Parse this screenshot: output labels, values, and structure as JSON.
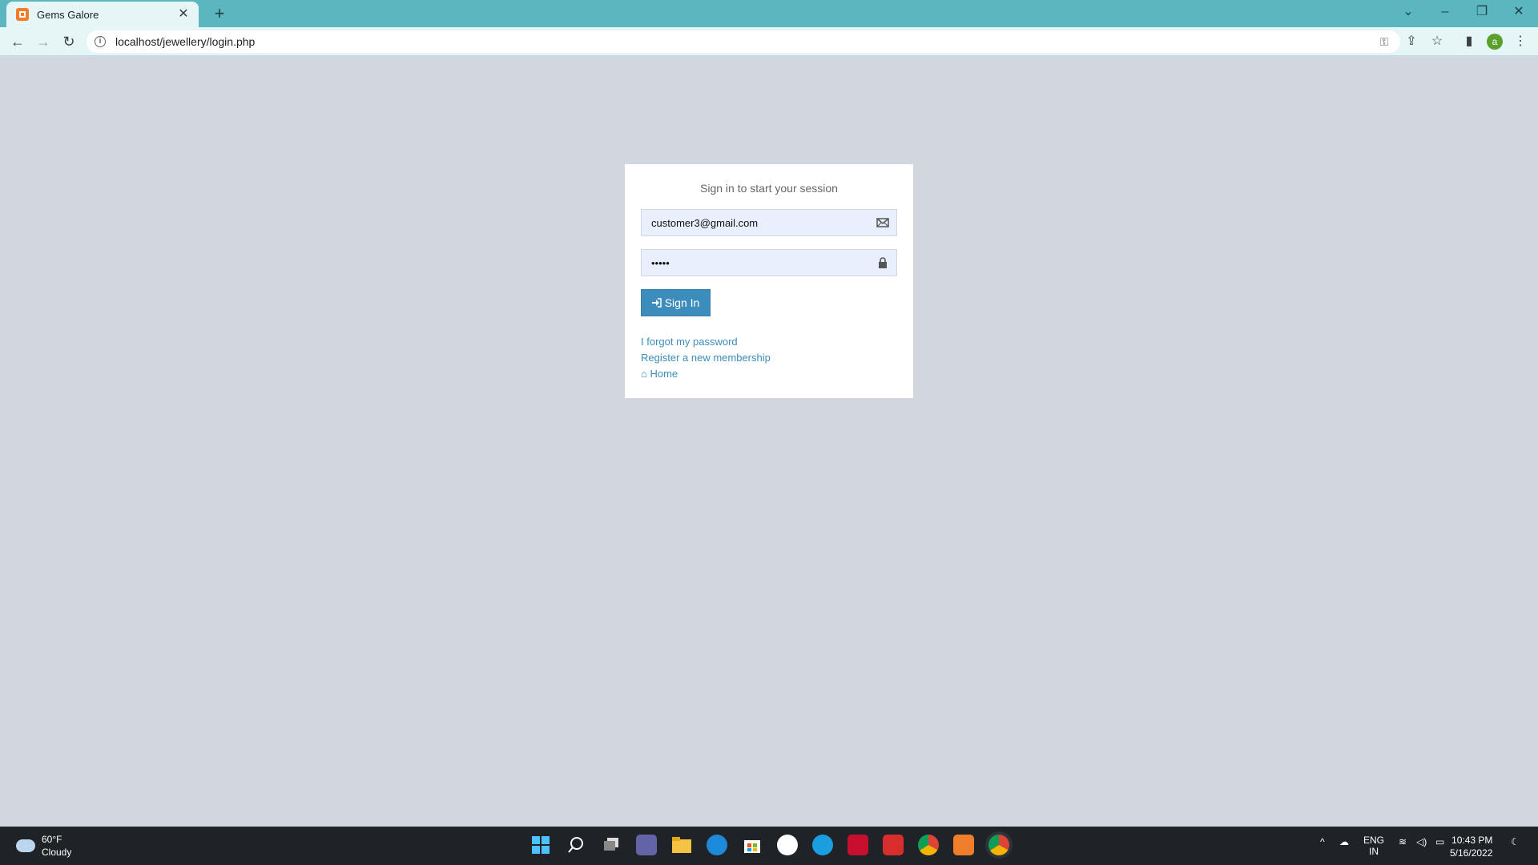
{
  "browser": {
    "tab_title": "Gems Galore",
    "url": "localhost/jewellery/login.php",
    "profile_initial": "a"
  },
  "login": {
    "message": "Sign in to start your session",
    "email_value": "customer3@gmail.com",
    "password_value": "•••••",
    "signin_label": "Sign In",
    "forgot_link": "I forgot my password",
    "register_link": "Register a new membership",
    "home_link": "Home"
  },
  "taskbar": {
    "weather_temp": "60°F",
    "weather_desc": "Cloudy",
    "lang_line1": "ENG",
    "lang_line2": "IN",
    "time": "10:43 PM",
    "date": "5/16/2022"
  },
  "colors": {
    "page_bg": "#d2d6de",
    "primary": "#3c8dbc",
    "chrome_teal": "#5bb6c0"
  }
}
